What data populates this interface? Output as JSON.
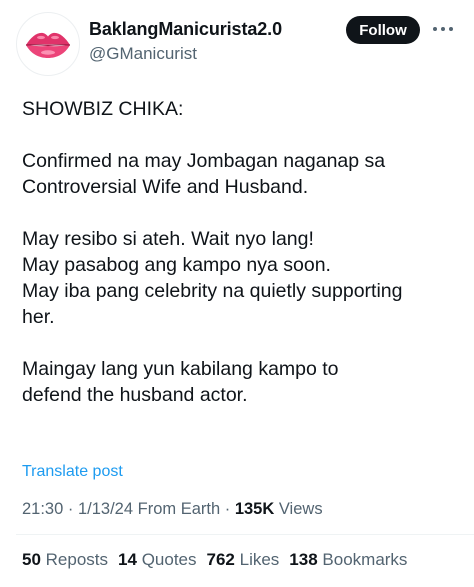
{
  "user": {
    "display_name": "BaklangManicurista2.0",
    "handle": "@GManicurist",
    "avatar_icon": "lips-icon"
  },
  "follow_label": "Follow",
  "more_icon": "more-horizontal-icon",
  "tweet": {
    "lines": [
      "SHOWBIZ CHIKA:",
      "",
      "Confirmed na may Jombagan naganap sa",
      "Controversial Wife and Husband.",
      "",
      "May resibo si ateh. Wait nyo lang!",
      "May pasabog ang kampo nya soon.",
      "May iba pang celebrity na quietly supporting",
      "her.",
      "",
      "Maingay lang yun kabilang kampo to",
      "defend the husband actor."
    ]
  },
  "translate_label": "Translate post",
  "meta": {
    "time": "21:30",
    "sep1": " · ",
    "date": "1/13/24",
    "source": " From Earth",
    "sep2": " · ",
    "views_count": "135K",
    "views_label": " Views"
  },
  "stats": {
    "reposts": {
      "count": "50",
      "label": "Reposts"
    },
    "quotes": {
      "count": "14",
      "label": "Quotes"
    },
    "likes": {
      "count": "762",
      "label": "Likes"
    },
    "bookmarks": {
      "count": "138",
      "label": "Bookmarks"
    }
  },
  "colors": {
    "accent": "#1d9bf0",
    "text": "#0f1419",
    "secondary": "#536471",
    "lips": "#e8386a"
  }
}
